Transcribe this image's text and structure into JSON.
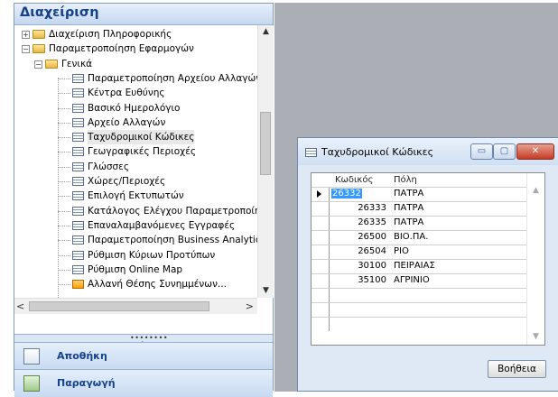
{
  "nav": {
    "header": "Διαχείριση",
    "tree": [
      {
        "label": "Διαχείριση Πληροφορικής",
        "icon": "folder-icon",
        "expander": "+"
      },
      {
        "label": "Παραμετροποίηση Εφαρμογών",
        "icon": "folder-open-icon",
        "expander": "−"
      },
      {
        "label": "Γενικά",
        "icon": "folder-open-icon",
        "expander": "−"
      },
      {
        "label": "Παραμετροποίηση Αρχείου Αλλαγών",
        "icon": "table-icon"
      },
      {
        "label": "Κέντρα Ευθύνης",
        "icon": "table-icon"
      },
      {
        "label": "Βασικό Ημερολόγιο",
        "icon": "table-icon"
      },
      {
        "label": "Αρχείο Αλλαγών",
        "icon": "table-icon"
      },
      {
        "label": "Ταχυδρομικοί Κώδικες",
        "icon": "table-icon",
        "selected": true
      },
      {
        "label": "Γεωγραφικές Περιοχές",
        "icon": "table-icon"
      },
      {
        "label": "Γλώσσες",
        "icon": "table-icon"
      },
      {
        "label": "Χώρες/Περιοχές",
        "icon": "table-icon"
      },
      {
        "label": "Επιλογή Εκτυπωτών",
        "icon": "table-icon"
      },
      {
        "label": "Κατάλογος Ελέγχου Παραμετροποίησης",
        "icon": "table-icon"
      },
      {
        "label": "Επαναλαμβανόμενες Εγγραφές",
        "icon": "table-icon"
      },
      {
        "label": "Παραμετροποίηση Business Analytics",
        "icon": "table-icon"
      },
      {
        "label": "Ρύθμιση Κύριων Προτύπων",
        "icon": "table-icon"
      },
      {
        "label": "Ρύθμιση Online Map",
        "icon": "table-icon"
      },
      {
        "label": "Αλλανή Θέσης Συνημμένων...",
        "icon": "form-icon"
      }
    ],
    "buttons": [
      {
        "label": "Αποθήκη",
        "icon": "warehouse-icon"
      },
      {
        "label": "Παραγωγή",
        "icon": "production-icon"
      }
    ]
  },
  "dialog": {
    "title": "Ταχυδρομικοί Κώδικες",
    "controls": {
      "minimize": "▭",
      "maximize": "▢",
      "close": "✕"
    },
    "columns": {
      "code": "Κωδικός",
      "city": "Πόλη"
    },
    "rows": [
      {
        "code": "26332",
        "city": "ΠΑΤΡΑ",
        "current": true
      },
      {
        "code": "26333",
        "city": "ΠΑΤΡΑ"
      },
      {
        "code": "26335",
        "city": "ΠΑΤΡΑ"
      },
      {
        "code": "26500",
        "city": "ΒΙΟ.ΠΑ."
      },
      {
        "code": "26504",
        "city": "ΡΙΟ"
      },
      {
        "code": "30100",
        "city": "ΠΕΙΡΑΙΑΣ"
      },
      {
        "code": "35100",
        "city": "ΑΓΡΙΝΙΟ"
      },
      {
        "code": "",
        "city": ""
      },
      {
        "code": "",
        "city": ""
      },
      {
        "code": "",
        "city": ""
      }
    ],
    "help_button": "Βοήθεια"
  }
}
